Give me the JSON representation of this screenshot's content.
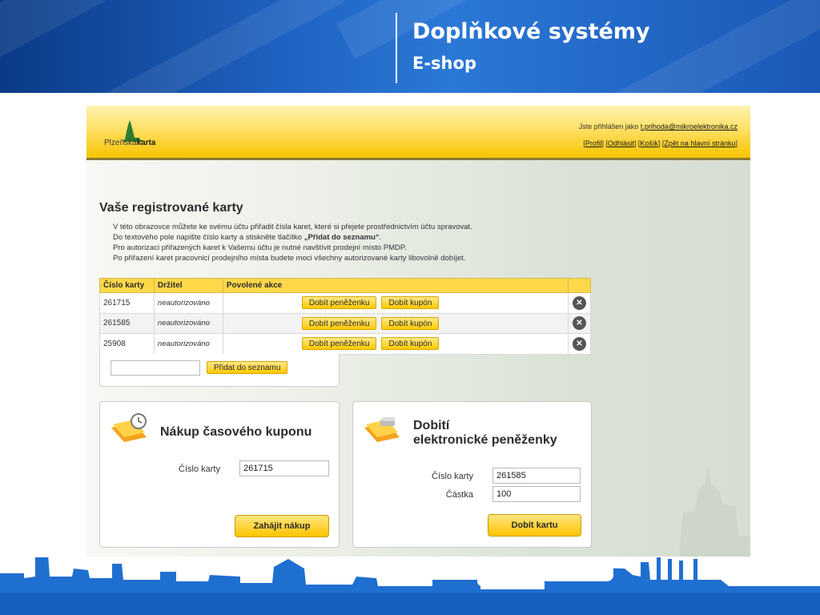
{
  "slide": {
    "title": "Doplňkové systémy",
    "subtitle": "E-shop"
  },
  "app": {
    "logo_text_light": "Plzeňská",
    "logo_text_bold": "karta",
    "login_prefix": "Jste přihlášen jako ",
    "login_email": "t.prihoda@mikroelektronika.cz",
    "links": [
      "Profil",
      "Odhlásit",
      "Košík",
      "Zpět na hlavní stránku"
    ]
  },
  "main": {
    "heading": "Vaše registrované karty",
    "intro": [
      "V této obrazovce můžete ke svému účtu přiřadit čísla karet, které si přejete prostřednictvím účtu spravovat.",
      "Do textového pole napište číslo karty a stiskněte tlačítko ",
      "„Přidat do seznamu“",
      ".",
      "Pro autorizaci přiřazených karet k Vašemu účtu je nutné navštívit prodejní místo PMDP.",
      "Po přiřazení karet pracovnicí prodejního místa budete moci všechny autorizované karty libovolně dobíjet."
    ],
    "table": {
      "headers": [
        "Číslo karty",
        "Držitel",
        "Povolené akce"
      ],
      "rows": [
        {
          "card": "261715",
          "holder": "neautorizováno",
          "btn1": "Dobít peněženku",
          "btn2": "Dobít kupón"
        },
        {
          "card": "261585",
          "holder": "neautorizováno",
          "btn1": "Dobít peněženku",
          "btn2": "Dobít kupón"
        },
        {
          "card": "25908",
          "holder": "neautorizováno",
          "btn1": "Dobít peněženku",
          "btn2": "Dobít kupón"
        }
      ]
    },
    "add": {
      "value": "",
      "button": "Přidat do seznamu"
    },
    "coupon": {
      "title": "Nákup časového kuponu",
      "card_label": "Číslo karty",
      "card_value": "261715",
      "button": "Zahájit nákup"
    },
    "wallet": {
      "title_line1": "Dobití",
      "title_line2": "elektronické peněženky",
      "card_label": "Číslo karty",
      "card_value": "261585",
      "amount_label": "Částka",
      "amount_value": "100",
      "button": "Dobít kartu"
    }
  },
  "colors": {
    "header_blue": "#1f63c2",
    "accent_yellow": "#ffc800",
    "footer_blue": "#1f6fd0"
  }
}
